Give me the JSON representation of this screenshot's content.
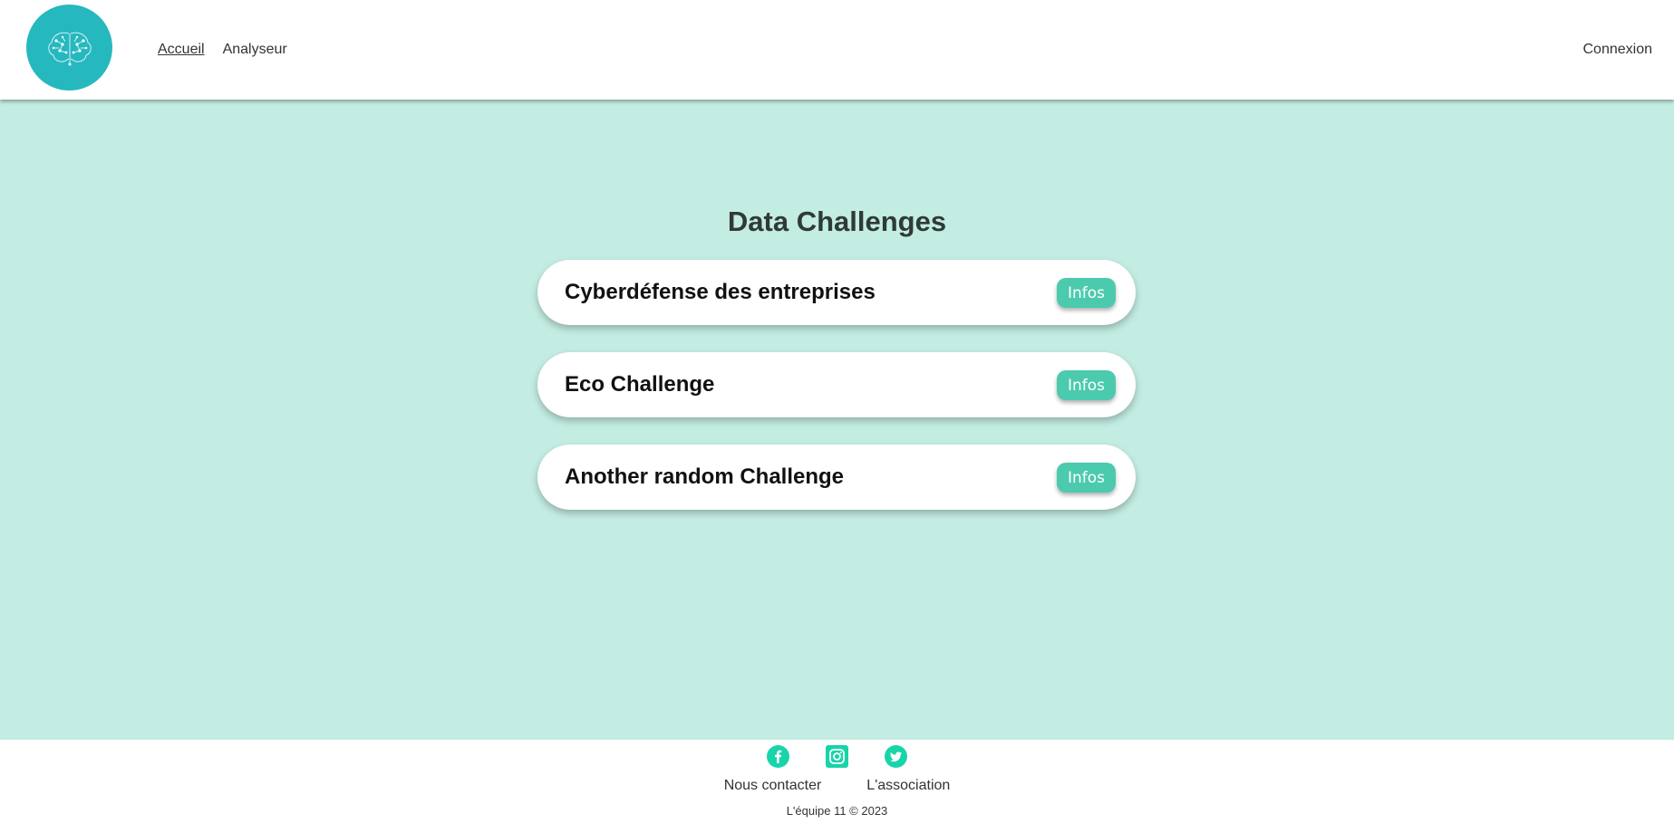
{
  "header": {
    "logo_icon": "brain-circuit-icon",
    "nav": [
      {
        "label": "Accueil",
        "active": true
      },
      {
        "label": "Analyseur",
        "active": false
      }
    ],
    "login_label": "Connexion"
  },
  "main": {
    "title": "Data Challenges",
    "challenges": [
      {
        "title": "Cyberdéfense des entreprises",
        "button_label": "Infos"
      },
      {
        "title": "Eco Challenge",
        "button_label": "Infos"
      },
      {
        "title": "Another random Challenge",
        "button_label": "Infos"
      }
    ]
  },
  "footer": {
    "socials": [
      "facebook-icon",
      "instagram-icon",
      "twitter-icon"
    ],
    "links": [
      "Nous contacter",
      "L'association"
    ],
    "copyright": "L'équipe 11 © 2023"
  },
  "colors": {
    "accent": "#4ccaae",
    "background": "#c3ece2",
    "logo": "#26b8bf",
    "social_icon": "#18d4aa"
  }
}
